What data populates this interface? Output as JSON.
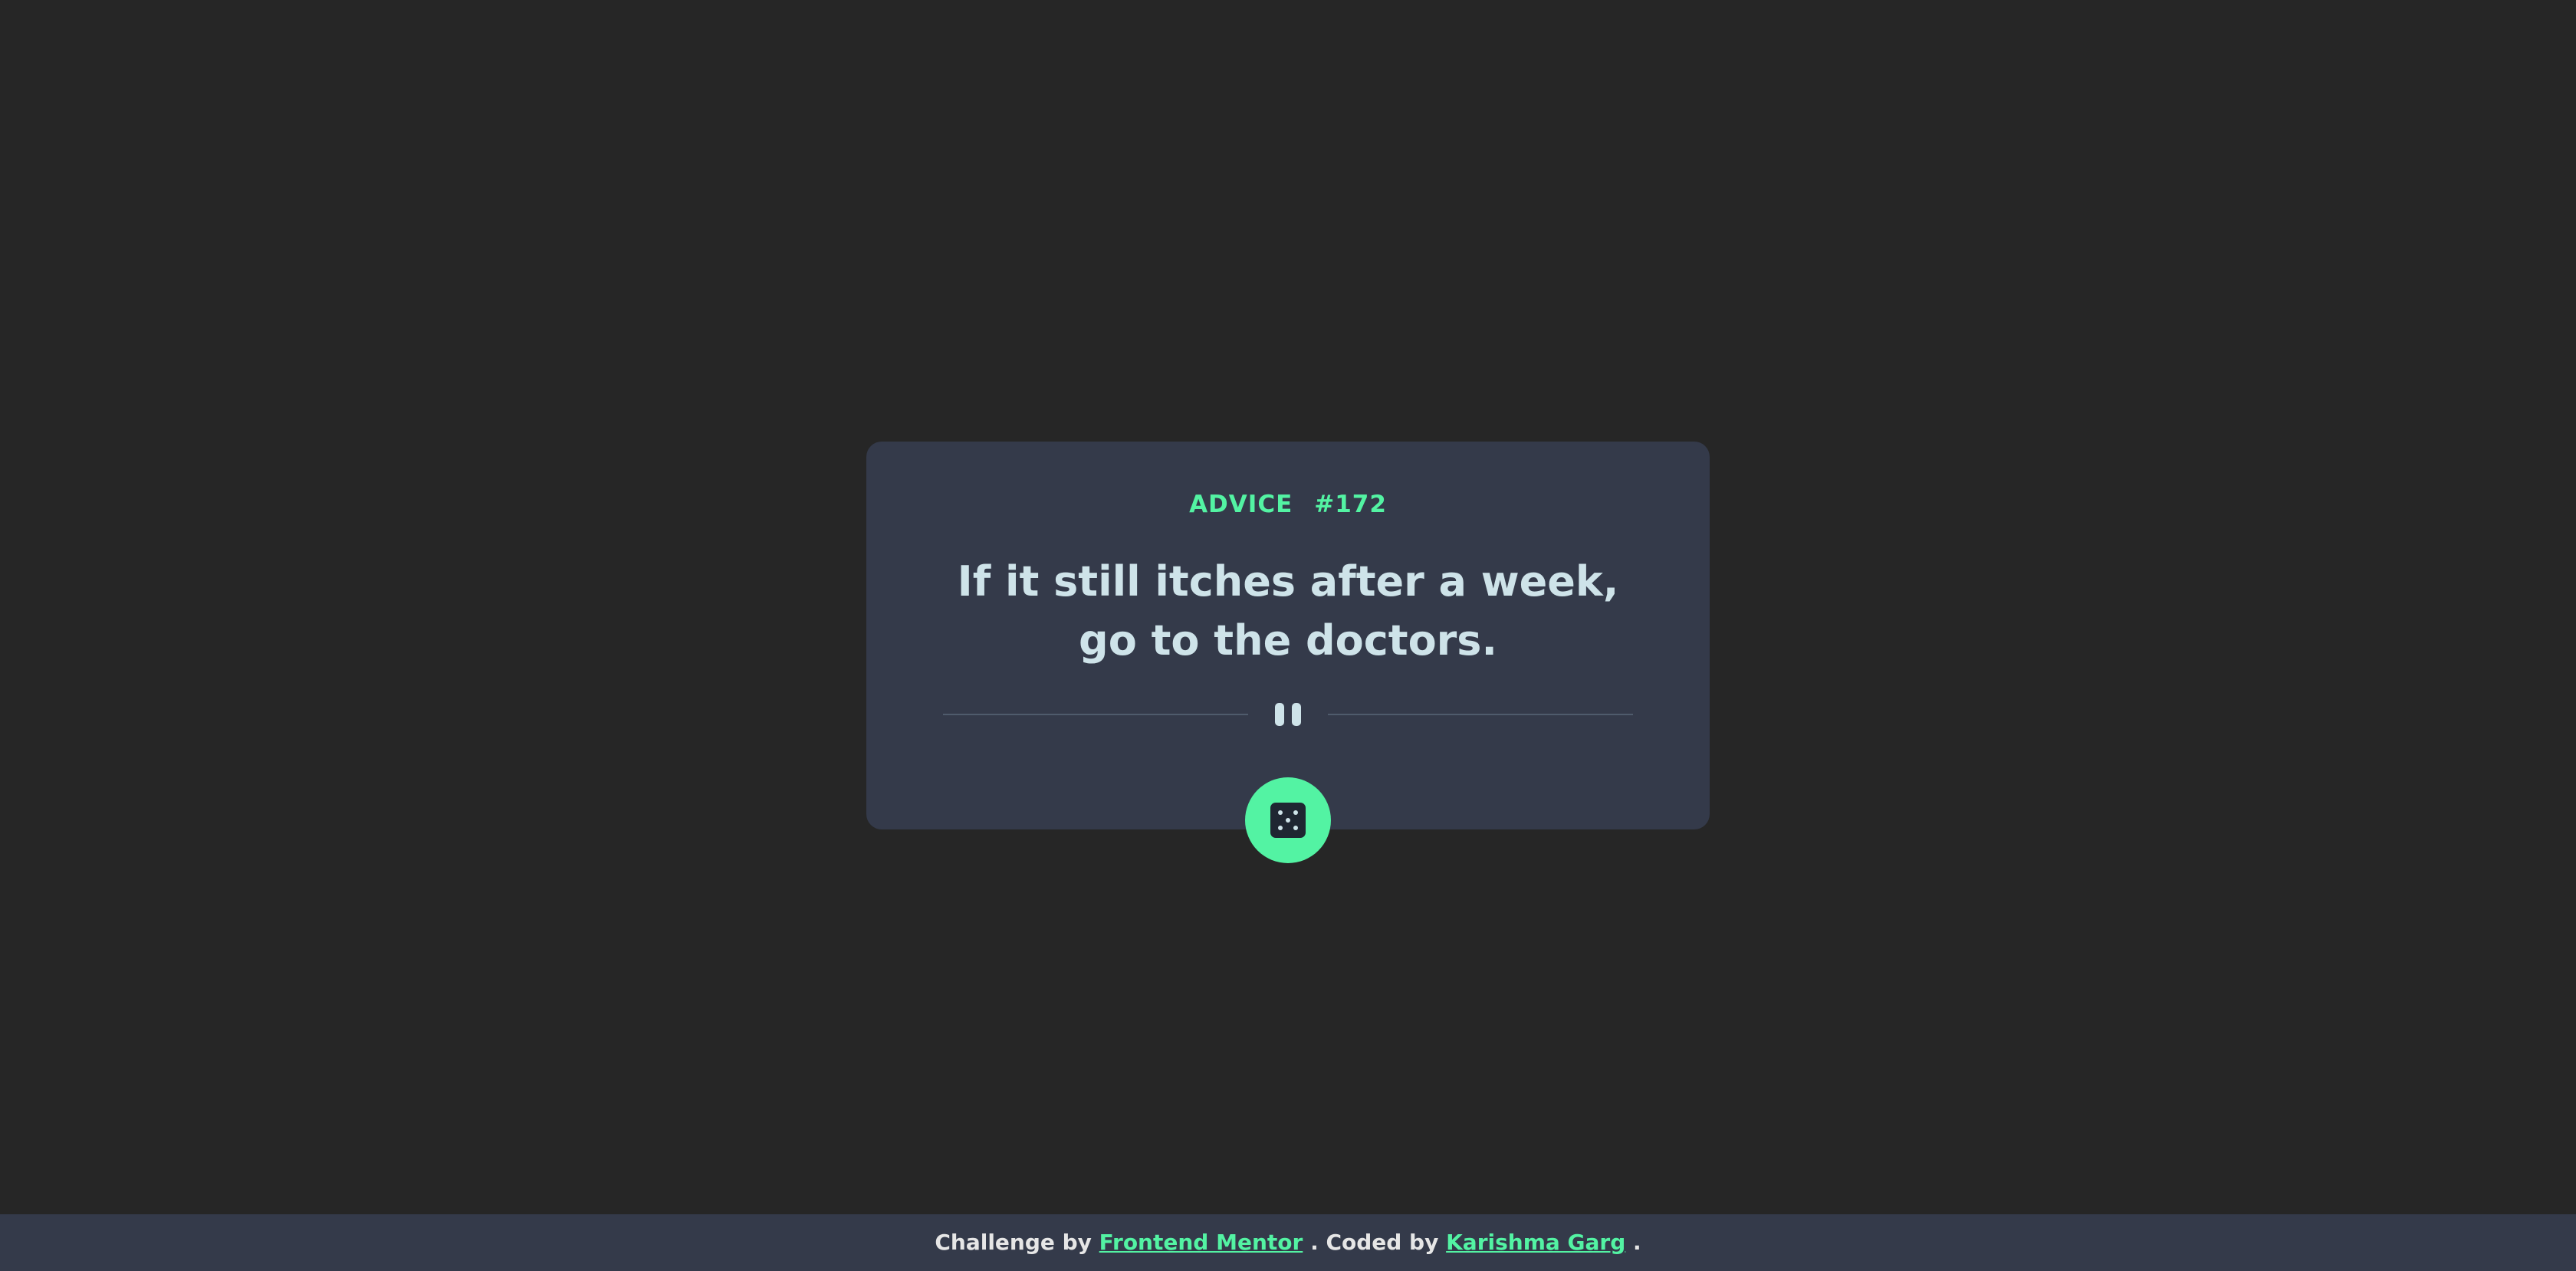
{
  "advice": {
    "label": "ADVICE",
    "number": "#172",
    "quote": "If it still itches after a week, go to the doctors."
  },
  "button": {
    "icon": "dice-icon"
  },
  "footer": {
    "challenge_by": "Challenge by",
    "frontend_mentor": "Frontend Mentor",
    "coded_by": ". Coded by",
    "author": "Karishma Garg",
    "end": "."
  },
  "colors": {
    "background": "#262626",
    "card": "#343a4a",
    "accent": "#53f3a3",
    "text": "#cee3e9"
  }
}
